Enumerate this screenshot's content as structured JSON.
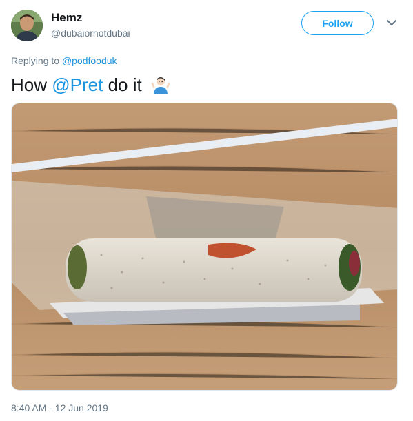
{
  "user": {
    "display_name": "Hemz",
    "handle": "@dubaiornotdubai",
    "follow_label": "Follow"
  },
  "reply": {
    "prefix": "Replying to",
    "to": "@podfooduk"
  },
  "tweet": {
    "word1": "How",
    "mention": "@Pret",
    "word2": "do it",
    "emoji": "man-shrugging-emoji"
  },
  "timestamp": "8:40 AM - 12 Jun 2019",
  "colors": {
    "accent": "#1da1f2",
    "link": "#1b95e0",
    "muted": "#657786"
  }
}
